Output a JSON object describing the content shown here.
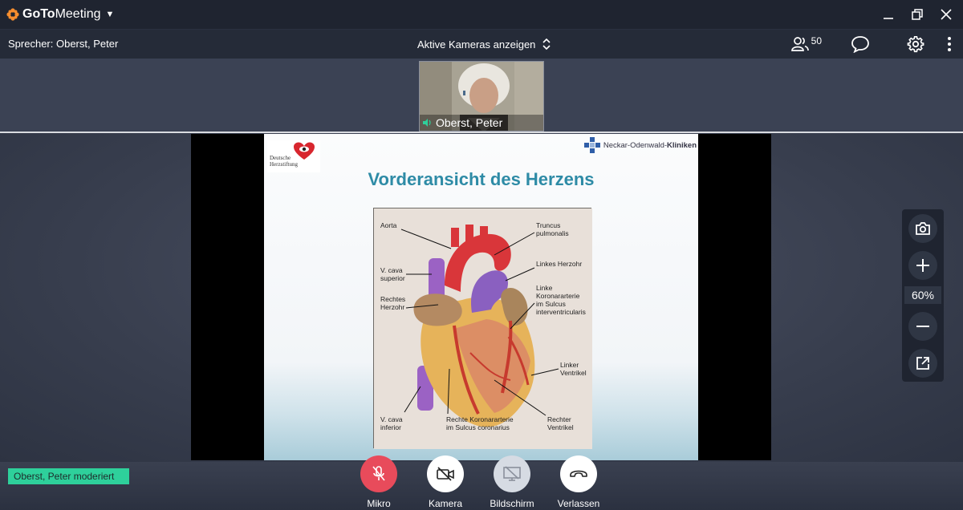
{
  "app": {
    "brand_bold": "GoTo",
    "brand_regular": "Meeting"
  },
  "toolbar": {
    "speaker": "Sprecher: Oberst, Peter",
    "camera_toggle": "Aktive Kameras anzeigen",
    "attendee_count": "50"
  },
  "camera": {
    "name": "Oberst, Peter"
  },
  "slide": {
    "org_left": "Deutsche Herzstiftung",
    "org_right_regular": "Neckar-Odenwald-",
    "org_right_bold": "Kliniken",
    "title": "Vorderansicht des Herzens",
    "labels": {
      "aorta": "Aorta",
      "truncus": "Truncus\npulmonalis",
      "vcava_sup": "V. cava\nsuperior",
      "linkes_herzohr": "Linkes Herzohr",
      "rechtes_herzohr": "Rechtes\nHerzohr",
      "linke_koronar": "Linke\nKoronararterie\nim Sulcus\ninterventricularis",
      "linker_ventrikel": "Linker\nVentrikel",
      "vcava_inf": "V. cava\ninferior",
      "rechte_koronar": "Rechte Koronararterie\nim Sulcus coronarius",
      "rechter_ventrikel": "Rechter\nVentrikel"
    }
  },
  "zoom": {
    "level": "60%"
  },
  "moderator": "Oberst, Peter moderiert",
  "controls": {
    "mic": "Mikro",
    "camera": "Kamera",
    "screen": "Bildschirm",
    "leave": "Verlassen"
  },
  "colors": {
    "brand_orange": "#f68d2e",
    "mic_red": "#e84b5b",
    "moderator_green": "#2ed09b",
    "slide_title": "#2e8ba6"
  },
  "icons": {
    "attendees": "people-icon",
    "chat": "chat-bubble-icon",
    "settings": "gear-icon",
    "more": "kebab-menu-icon",
    "snapshot": "camera-snapshot-icon",
    "zoom_in": "plus-icon",
    "zoom_out": "minus-icon",
    "popout": "external-window-icon"
  }
}
